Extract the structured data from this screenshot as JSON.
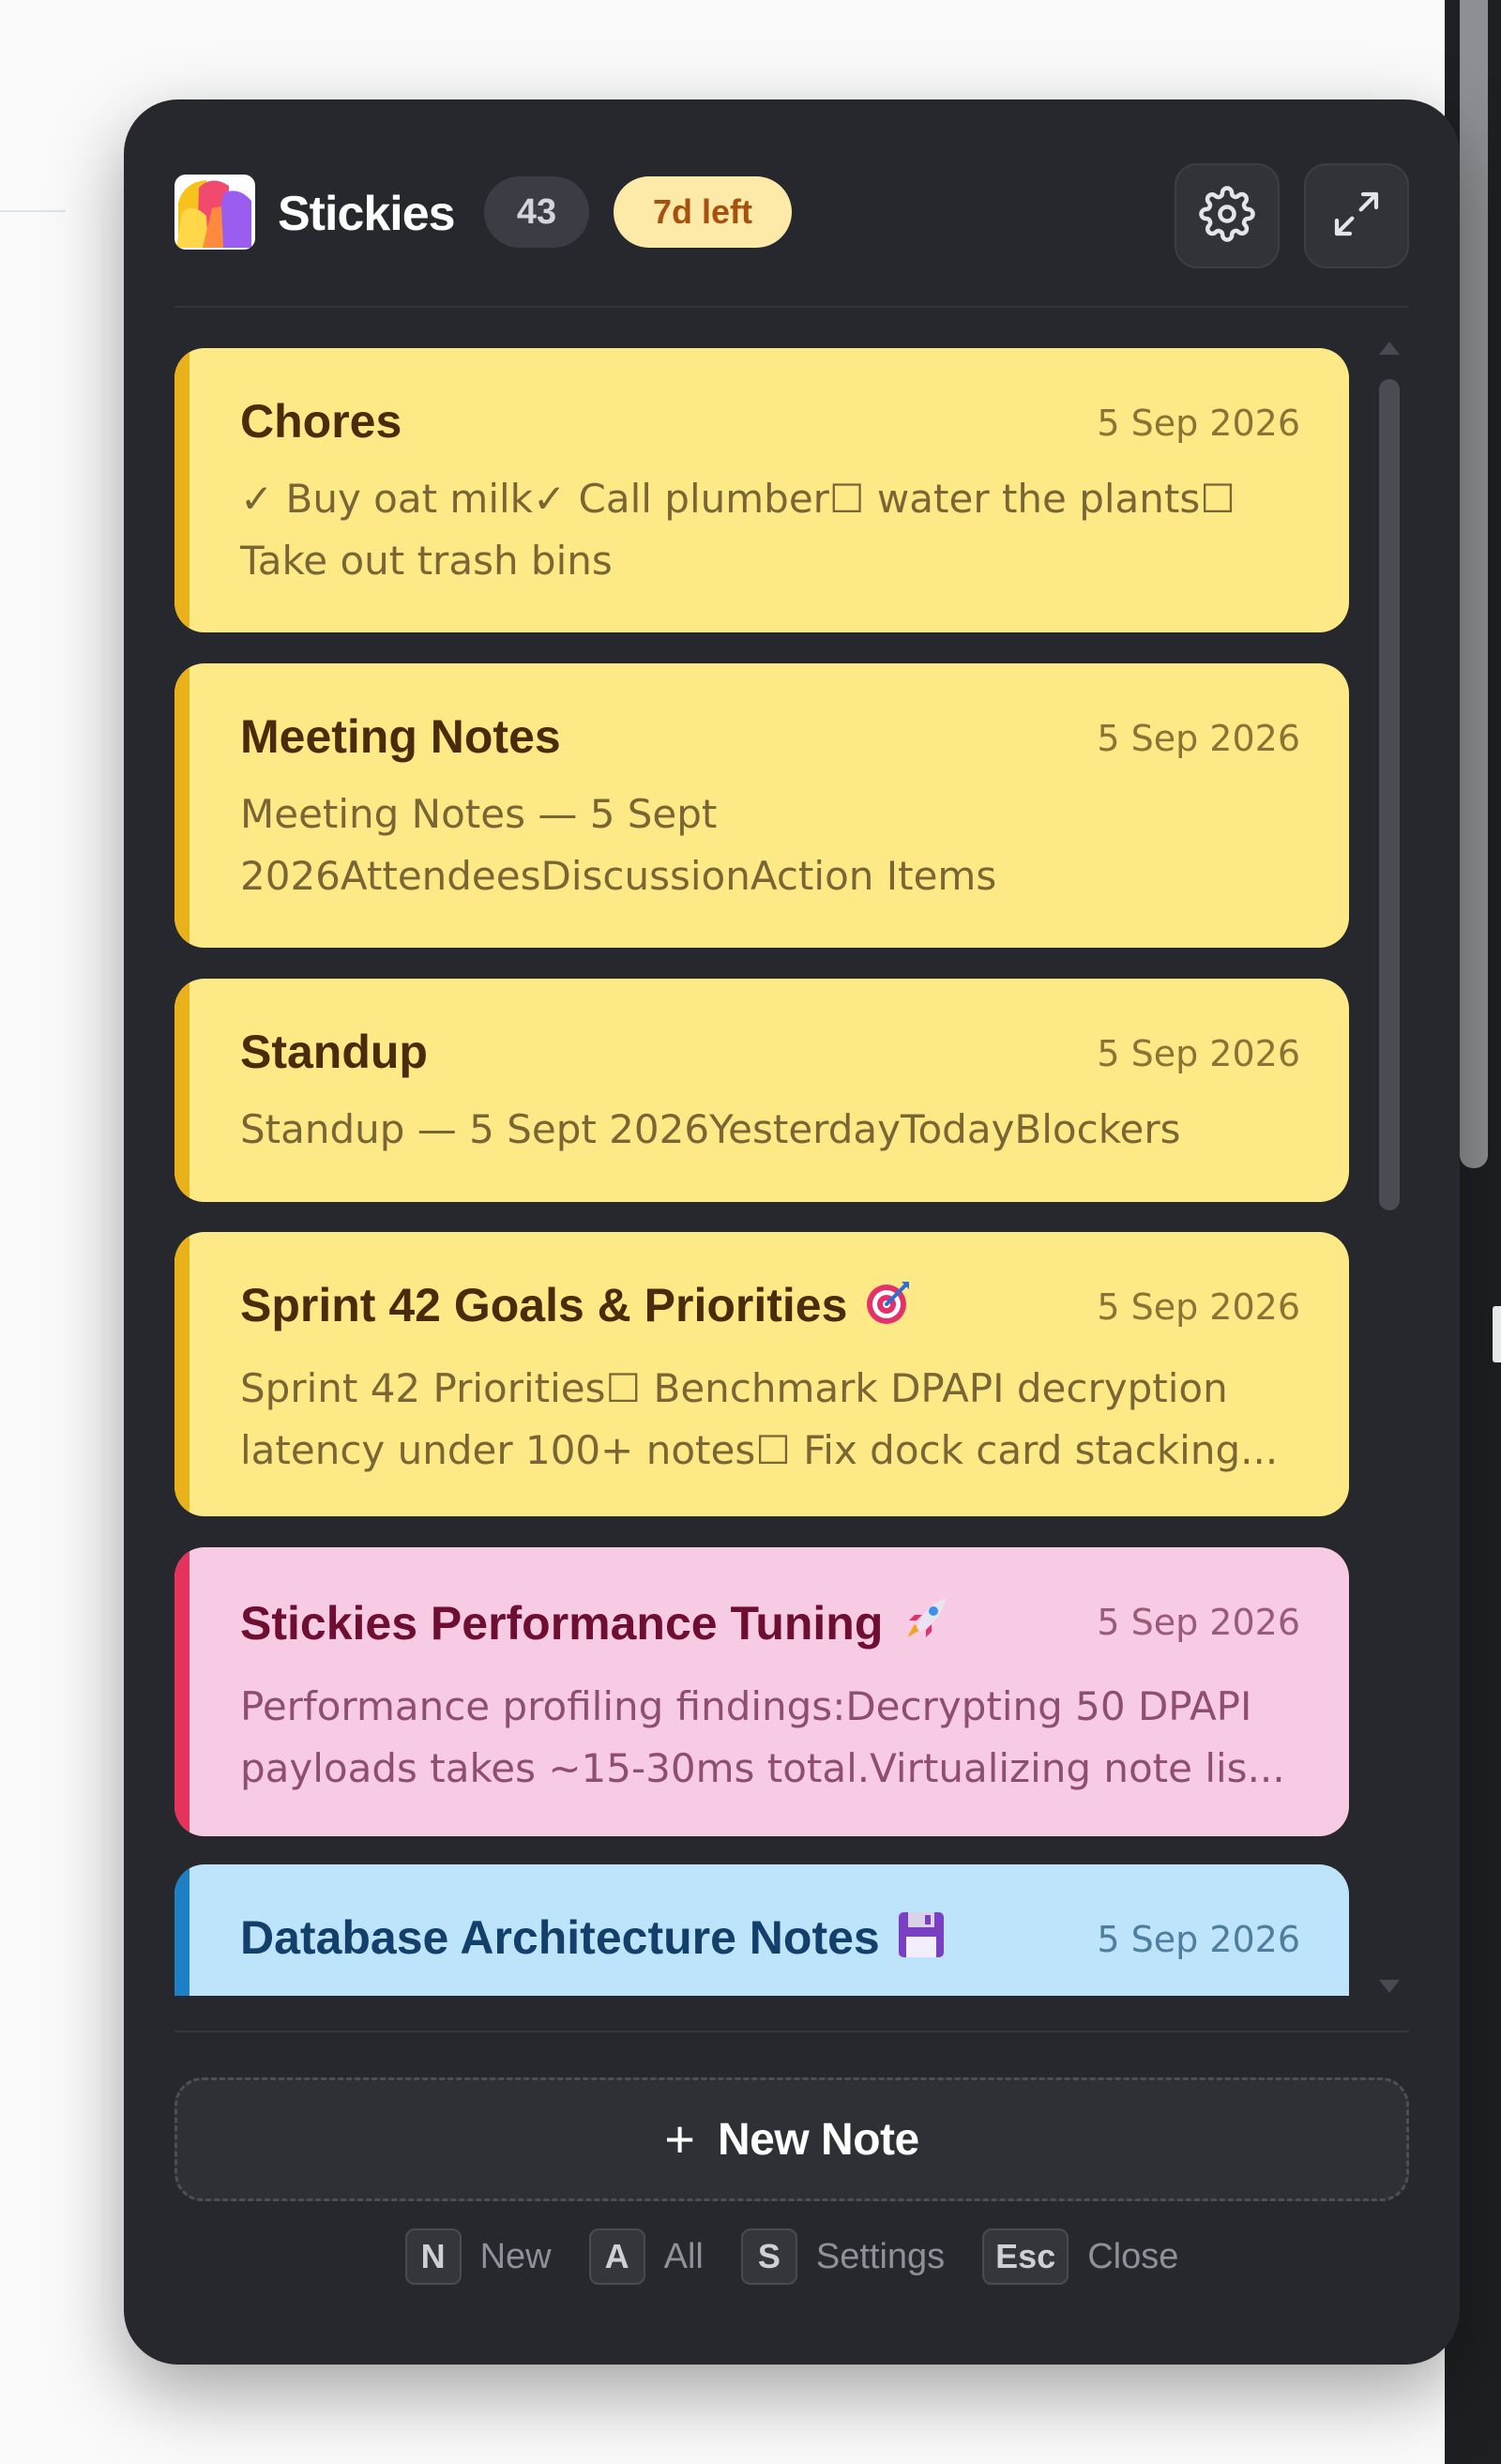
{
  "app": {
    "title": "Stickies",
    "note_count": "43",
    "trial_badge": "7d left"
  },
  "header_buttons": [
    {
      "name": "settings",
      "icon": "gear-icon"
    },
    {
      "name": "expand",
      "icon": "expand-icon"
    }
  ],
  "notes": [
    {
      "title": "Chores",
      "date": "5 Sep 2026",
      "preview": "✓ Buy oat milk✓ Call plumber☐ water the plants☐ Take out trash bins",
      "color": "yellow"
    },
    {
      "title": "Meeting Notes",
      "date": "5 Sep 2026",
      "preview": "Meeting Notes — 5 Sept 2026AttendeesDiscussionAction Items",
      "color": "yellow"
    },
    {
      "title": "Standup",
      "date": "5 Sep 2026",
      "preview": "Standup — 5 Sept 2026YesterdayTodayBlockers",
      "color": "yellow"
    },
    {
      "title": "Sprint 42 Goals & Priorities",
      "emoji": "target-icon",
      "date": "5 Sep 2026",
      "preview": "Sprint 42 Priorities☐ Benchmark DPAPI decryption latency under 100+ notes☐ Fix dock card stacking...",
      "color": "yellow"
    },
    {
      "title": "Stickies Performance Tuning",
      "emoji": "rocket-icon",
      "date": "5 Sep 2026",
      "preview": "Performance profiling findings:Decrypting 50 DPAPI payloads takes ~15-30ms total.Virtualizing note lis...",
      "color": "pink"
    },
    {
      "title": "Database Architecture Notes",
      "emoji": "floppy-disk-icon",
      "date": "5 Sep 2026",
      "preview": "",
      "color": "blue"
    }
  ],
  "new_note": {
    "icon": "plus-icon",
    "label": "New Note"
  },
  "shortcuts": [
    {
      "key": "N",
      "label": "New"
    },
    {
      "key": "A",
      "label": "All"
    },
    {
      "key": "S",
      "label": "Settings"
    },
    {
      "key": "Esc",
      "label": "Close"
    }
  ],
  "colors": {
    "panel_bg": "#27282e",
    "yellow_card": "#fdea87",
    "pink_card": "#f8cbe4",
    "blue_card": "#bde4fb",
    "trial_badge_bg": "#fde9a8"
  }
}
